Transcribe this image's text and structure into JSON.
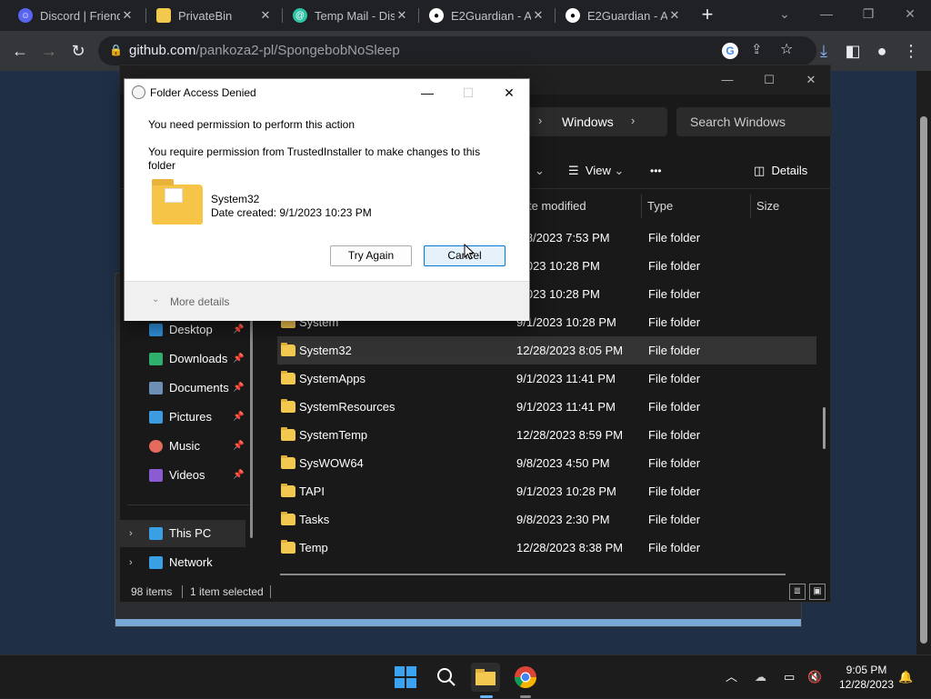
{
  "browser": {
    "tabs": [
      {
        "title": "Discord | Friends",
        "icon": "discord-icon",
        "color": "#5865f2"
      },
      {
        "title": "PrivateBin",
        "icon": "privatebin-icon",
        "color": "#f2c94c"
      },
      {
        "title": "Temp Mail - Dis",
        "icon": "tempmail-icon",
        "color": "#2ec4a6"
      },
      {
        "title": "E2Guardian - A",
        "icon": "github-icon",
        "color": "#ffffff"
      },
      {
        "title": "E2Guardian - A",
        "icon": "github-icon",
        "color": "#ffffff"
      }
    ],
    "url_host": "github.com",
    "url_path": "/pankoza2-pl/SpongebobNoSleep"
  },
  "explorer": {
    "breadcrumb_current": "Windows",
    "search_placeholder": "Search Windows",
    "cmd": {
      "view": "View",
      "more": "•••",
      "details": "Details"
    },
    "columns": {
      "date": "te modified",
      "type": "Type",
      "size": "Size"
    },
    "nav": [
      {
        "label": "Desktop",
        "icon": "desktop-icon",
        "color": "#2f8fd8",
        "pinned": true
      },
      {
        "label": "Downloads",
        "icon": "downloads-icon",
        "color": "#2fae6c",
        "pinned": true
      },
      {
        "label": "Documents",
        "icon": "documents-icon",
        "color": "#6d8fb5",
        "pinned": true
      },
      {
        "label": "Pictures",
        "icon": "pictures-icon",
        "color": "#3d9be0",
        "pinned": true
      },
      {
        "label": "Music",
        "icon": "music-icon",
        "color": "#e46a5b",
        "pinned": true
      },
      {
        "label": "Videos",
        "icon": "videos-icon",
        "color": "#8b5bd4",
        "pinned": true
      },
      {
        "label": "This PC",
        "icon": "this-pc-icon",
        "color": "#3aa0e6",
        "pinned": false
      },
      {
        "label": "Network",
        "icon": "network-icon",
        "color": "#3aa0e6",
        "pinned": false
      }
    ],
    "rows": [
      {
        "name": "",
        "date": "/28/2023 7:53 PM",
        "type": "File folder"
      },
      {
        "name": "",
        "date": "/2023 10:28 PM",
        "type": "File folder"
      },
      {
        "name": "",
        "date": "/2023 10:28 PM",
        "type": "File folder"
      },
      {
        "name": "System",
        "date": "9/1/2023 10:28 PM",
        "type": "File folder"
      },
      {
        "name": "System32",
        "date": "12/28/2023 8:05 PM",
        "type": "File folder",
        "selected": true
      },
      {
        "name": "SystemApps",
        "date": "9/1/2023 11:41 PM",
        "type": "File folder"
      },
      {
        "name": "SystemResources",
        "date": "9/1/2023 11:41 PM",
        "type": "File folder"
      },
      {
        "name": "SystemTemp",
        "date": "12/28/2023 8:59 PM",
        "type": "File folder"
      },
      {
        "name": "SysWOW64",
        "date": "9/8/2023 4:50 PM",
        "type": "File folder"
      },
      {
        "name": "TAPI",
        "date": "9/1/2023 10:28 PM",
        "type": "File folder"
      },
      {
        "name": "Tasks",
        "date": "9/8/2023 2:30 PM",
        "type": "File folder"
      },
      {
        "name": "Temp",
        "date": "12/28/2023 8:38 PM",
        "type": "File folder"
      }
    ],
    "status": {
      "items": "98 items",
      "selected": "1 item selected"
    }
  },
  "dialog": {
    "title": "Folder Access Denied",
    "line1": "You need permission to perform this action",
    "line2a": "You require permission from TrustedInstaller to make changes to this",
    "line2b": "folder",
    "folder_name": "System32",
    "folder_date": "Date created: 9/1/2023 10:23 PM",
    "btn_retry": "Try Again",
    "btn_cancel": "Cancel",
    "more_details": "More details"
  },
  "taskbar": {
    "time": "9:05 PM",
    "date": "12/28/2023"
  }
}
